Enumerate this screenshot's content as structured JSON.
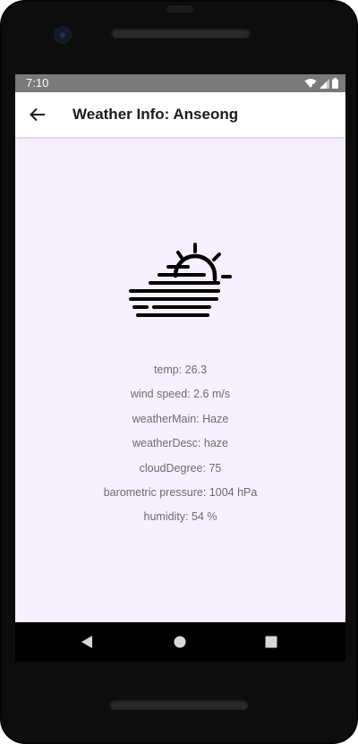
{
  "status_bar": {
    "time": "7:10",
    "icons": [
      "wifi-icon",
      "signal-icon",
      "battery-icon"
    ]
  },
  "app_bar": {
    "back_icon": "arrow-back-icon",
    "title": "Weather Info: Anseong"
  },
  "weather": {
    "icon": "haze-icon",
    "lines": [
      "temp: 26.3",
      "wind speed: 2.6 m/s",
      "weatherMain: Haze",
      "weatherDesc: haze",
      "cloudDegree: 75",
      "barometric pressure: 1004 hPa",
      "humidity: 54 %"
    ]
  },
  "nav_bar": {
    "buttons": [
      "back-triangle-icon",
      "home-circle-icon",
      "recents-square-icon"
    ]
  },
  "colors": {
    "screen_bg": "#f7f1ff",
    "status_bar_bg": "#7a7a7a",
    "app_bar_bg": "#ffffff",
    "text": "#6d6a73"
  }
}
